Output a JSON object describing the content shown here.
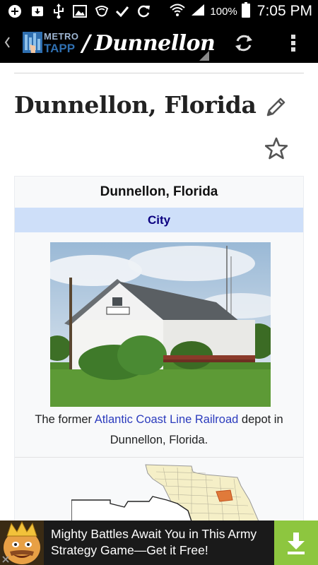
{
  "status_bar": {
    "battery_percent": "100%",
    "time": "7:05 PM",
    "icons": [
      "add-icon",
      "download-icon",
      "usb-icon",
      "image-icon",
      "wifi-shield-icon",
      "check-icon",
      "sync-icon",
      "wifi-icon",
      "signal-icon",
      "battery-icon"
    ]
  },
  "action_bar": {
    "logo_line1": "METRO",
    "logo_line2": "TAPP",
    "separator": "/",
    "title": "Dunnellon",
    "icons": [
      "back-chevron-icon",
      "refresh-icon",
      "overflow-menu-icon"
    ]
  },
  "article": {
    "title": "Dunnellon, Florida",
    "icons": [
      "pencil-icon",
      "star-icon"
    ]
  },
  "infobox": {
    "title": "Dunnellon, Florida",
    "type": "City",
    "caption_before": "The former ",
    "caption_link": "Atlantic Coast Line Railroad",
    "caption_after": " depot in Dunnellon, Florida."
  },
  "ad": {
    "text": "Mighty Battles Await You in This Army Strategy Game—Get it Free!",
    "icons": [
      "download-arrow-icon",
      "close-icon"
    ]
  },
  "colors": {
    "status_bar_bg": "#000000",
    "action_bar_bg": "#000000",
    "infobox_type_bg": "#cedff9",
    "link_color": "#2b3bbd",
    "ad_download_bg": "#8dc63f"
  }
}
